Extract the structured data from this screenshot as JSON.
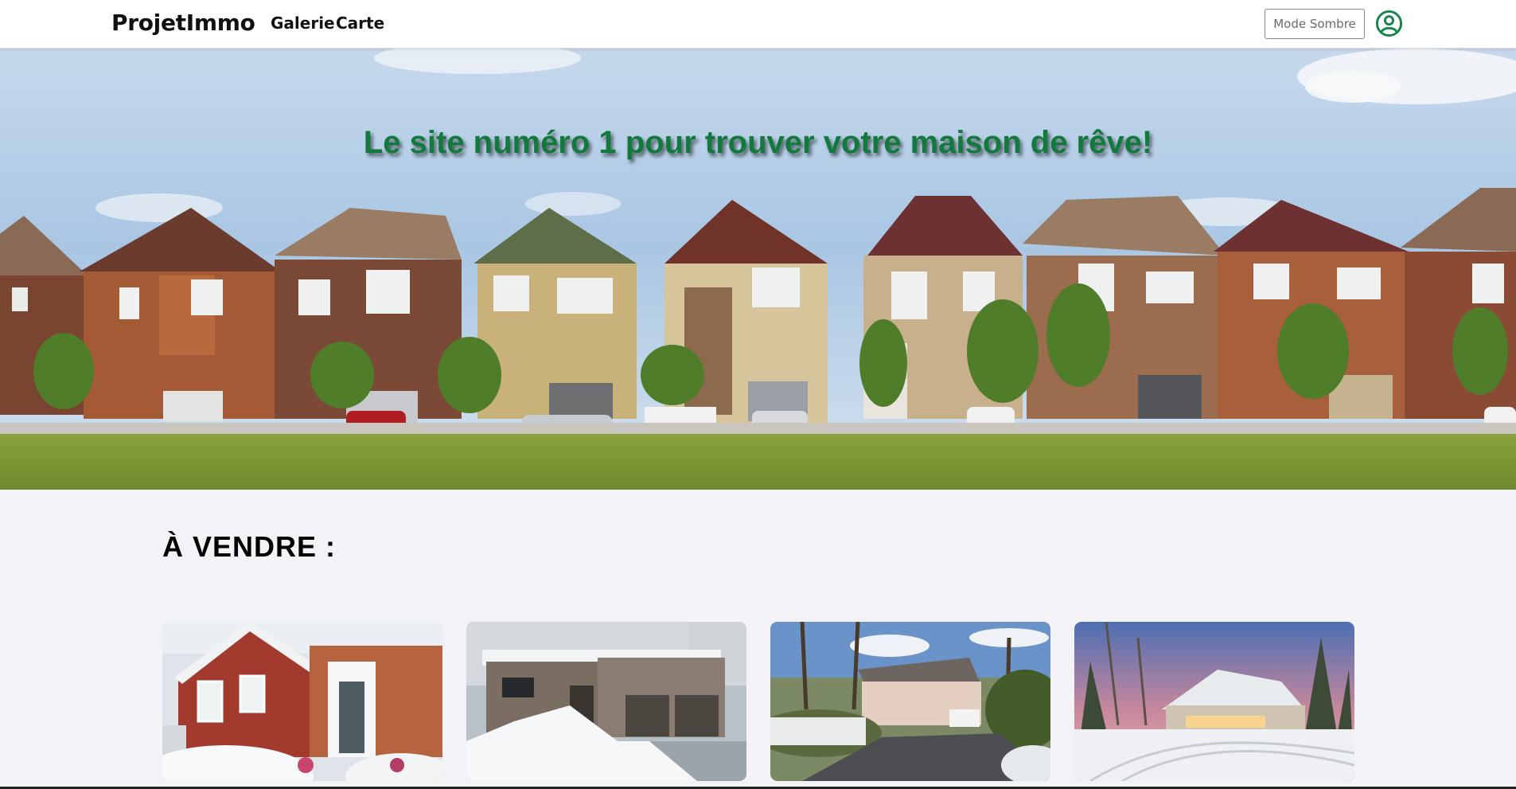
{
  "navbar": {
    "brand": "ProjetImmo",
    "links": [
      "Galerie",
      "Carte"
    ],
    "dark_mode_label": "Mode Sombre",
    "user_icon": "user-circle-icon",
    "accent_color": "#14854a"
  },
  "hero": {
    "title": "Le site numéro 1 pour trouver votre maison de rêve!",
    "title_color": "#137a3e",
    "image": "row of suburban brick houses under blue sky"
  },
  "listings": {
    "heading": "À VENDRE :",
    "cards": [
      {
        "image": "red siding and brick house with snow"
      },
      {
        "image": "modern stone house with double garage in snow"
      },
      {
        "image": "beige bungalow in woods with driveway"
      },
      {
        "image": "large house in snowy field at sunset"
      }
    ]
  }
}
